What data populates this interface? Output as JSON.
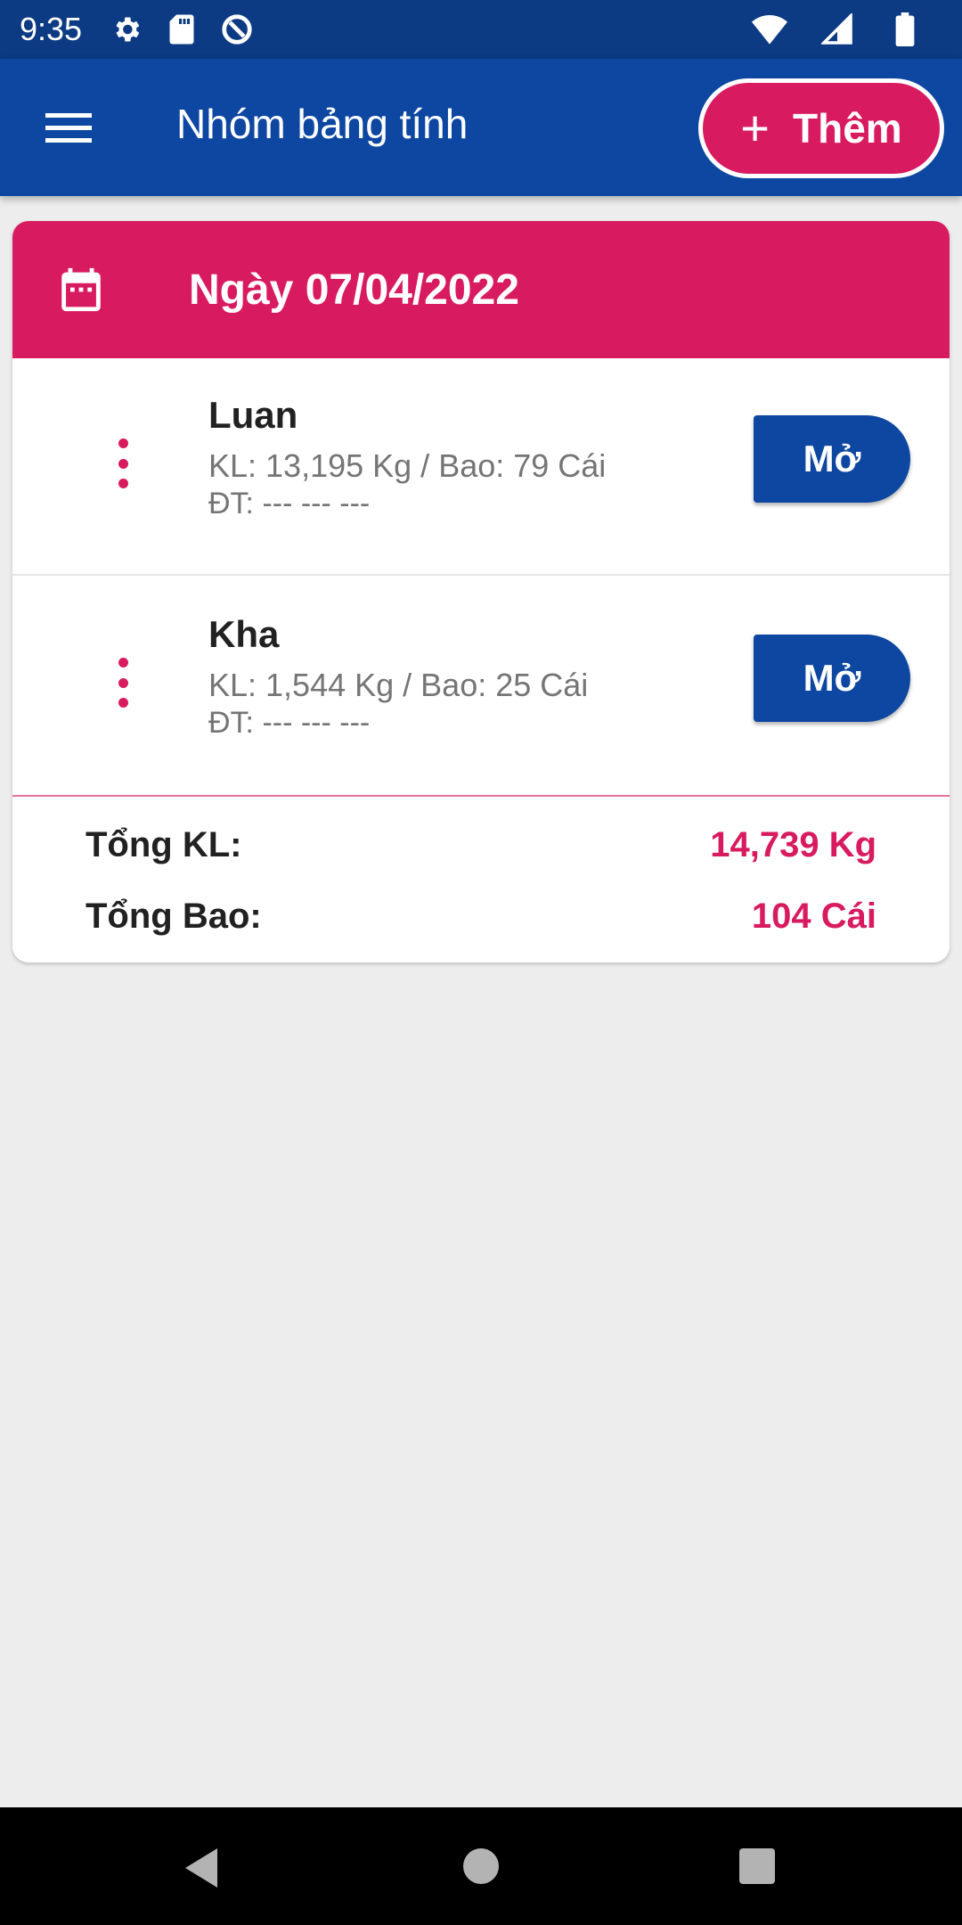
{
  "status_bar": {
    "time": "9:35",
    "left_icons": [
      "gear-icon",
      "sd-card-icon",
      "vpn-icon"
    ],
    "right_icons": [
      "wifi-icon",
      "signal-icon",
      "battery-icon"
    ]
  },
  "app_bar": {
    "title": "Nhóm bảng tính",
    "menu_icon": "hamburger-menu-icon",
    "add_button": {
      "icon": "plus-icon",
      "icon_glyph": "+",
      "label": "Thêm"
    }
  },
  "card": {
    "header": {
      "icon": "calendar-icon",
      "date": "Ngày 07/04/2022"
    },
    "rows": [
      {
        "name": "Luan",
        "kl": "KL: 13,195 Kg / Bao: 79 Cái",
        "dt": "ĐT: --- --- ---",
        "button": "Mở"
      },
      {
        "name": "Kha",
        "kl": "KL: 1,544 Kg / Bao: 25 Cái",
        "dt": "ĐT: --- --- ---",
        "button": "Mở"
      }
    ],
    "totals": {
      "kl_label": "Tổng KL:",
      "kl_value": "14,739 Kg",
      "bao_label": "Tổng Bao:",
      "bao_value": "104 Cái"
    }
  },
  "nav_bar": {
    "icons": [
      "back-icon",
      "home-icon",
      "recents-icon"
    ]
  },
  "colors": {
    "primary": "#0d47a1",
    "accent": "#d81b60",
    "background": "#ededed"
  }
}
